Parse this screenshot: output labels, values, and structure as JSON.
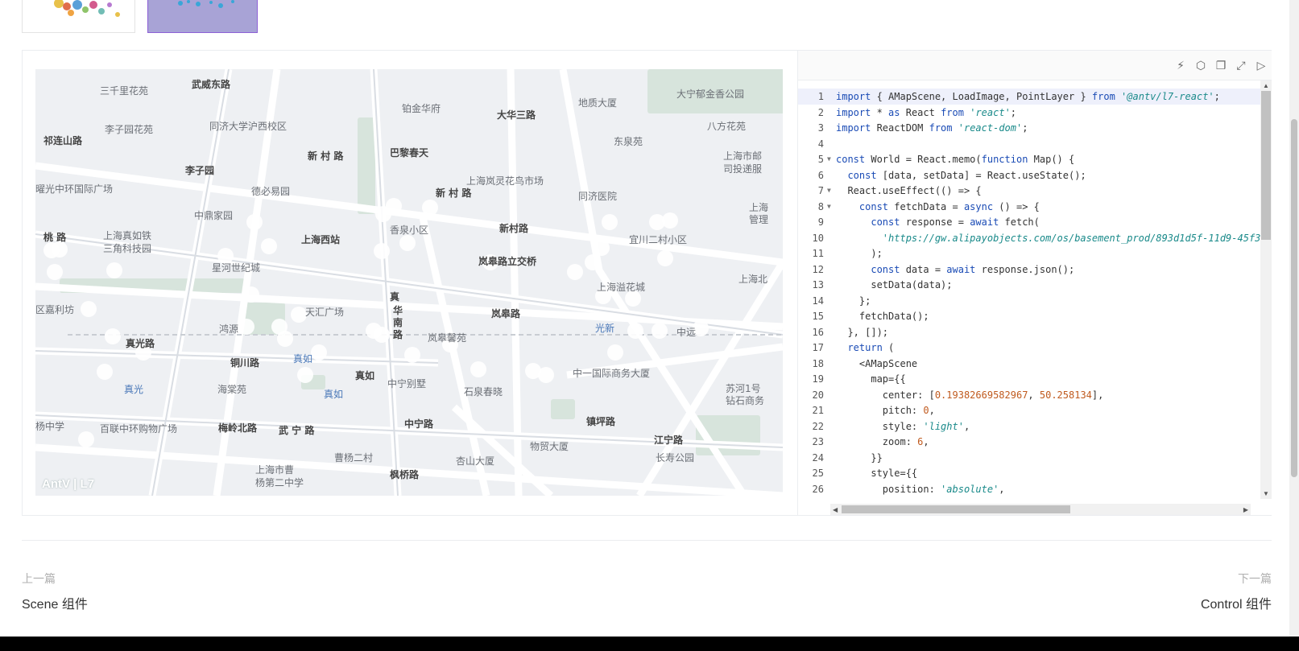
{
  "map": {
    "labels": [
      {
        "t": "三千里花苑",
        "cls": ""
      },
      {
        "t": "武威东路",
        "cls": "b"
      },
      {
        "t": "铂金华府",
        "cls": ""
      },
      {
        "t": "大华三路",
        "cls": "b"
      },
      {
        "t": "地质大厦",
        "cls": ""
      },
      {
        "t": "大宁郁金香公园",
        "cls": ""
      },
      {
        "t": "李子园花苑",
        "cls": ""
      },
      {
        "t": "同济大学沪西校区",
        "cls": ""
      },
      {
        "t": "八方花苑",
        "cls": ""
      },
      {
        "t": "祁连山路",
        "cls": "b"
      },
      {
        "t": "新 村 路",
        "cls": "b"
      },
      {
        "t": "巴黎春天",
        "cls": "b"
      },
      {
        "t": "东泉苑",
        "cls": ""
      },
      {
        "t": "上海市邮",
        "cls": ""
      },
      {
        "t": "司投递服",
        "cls": ""
      },
      {
        "t": "李子园",
        "cls": "b"
      },
      {
        "t": "上海岚灵花鸟市场",
        "cls": ""
      },
      {
        "t": "曜光中环国际广场",
        "cls": ""
      },
      {
        "t": "德必易园",
        "cls": ""
      },
      {
        "t": "新 村 路",
        "cls": "b"
      },
      {
        "t": "同济医院",
        "cls": ""
      },
      {
        "t": "上海",
        "cls": ""
      },
      {
        "t": "管理",
        "cls": ""
      },
      {
        "t": "中鼎家园",
        "cls": ""
      },
      {
        "t": "香泉小区",
        "cls": ""
      },
      {
        "t": "新村路",
        "cls": "b"
      },
      {
        "t": "宜川二村小区",
        "cls": ""
      },
      {
        "t": "桃  路",
        "cls": "b"
      },
      {
        "t": "上海真如铁",
        "cls": ""
      },
      {
        "t": "三角科技园",
        "cls": ""
      },
      {
        "t": "上海西站",
        "cls": "b"
      },
      {
        "t": "岚皋路立交桥",
        "cls": "b"
      },
      {
        "t": "星河世纪城",
        "cls": ""
      },
      {
        "t": "上海北",
        "cls": ""
      },
      {
        "t": "上海溢花城",
        "cls": ""
      },
      {
        "t": "区嘉利坊",
        "cls": ""
      },
      {
        "t": "天汇广场",
        "cls": ""
      },
      {
        "t": "岚皋路",
        "cls": "b"
      },
      {
        "t": "光新",
        "cls": "blue"
      },
      {
        "t": "鸿源",
        "cls": ""
      },
      {
        "t": "岚皋馨苑",
        "cls": ""
      },
      {
        "t": "中远",
        "cls": ""
      },
      {
        "t": "真光路",
        "cls": "b"
      },
      {
        "t": "铜川路",
        "cls": "b"
      },
      {
        "t": "真如",
        "cls": "blue"
      },
      {
        "t": "中一国际商务大厦",
        "cls": ""
      },
      {
        "t": "真如",
        "cls": "b"
      },
      {
        "t": "中宁别墅",
        "cls": ""
      },
      {
        "t": "真光",
        "cls": "blue"
      },
      {
        "t": "海棠苑",
        "cls": ""
      },
      {
        "t": "真如",
        "cls": "blue"
      },
      {
        "t": "石泉春晓",
        "cls": ""
      },
      {
        "t": "苏河1号",
        "cls": ""
      },
      {
        "t": "钻石商务",
        "cls": ""
      },
      {
        "t": "杨中学",
        "cls": ""
      },
      {
        "t": "百联中环购物广场",
        "cls": ""
      },
      {
        "t": "梅岭北路",
        "cls": "b"
      },
      {
        "t": "武 宁 路",
        "cls": "b"
      },
      {
        "t": "中宁路",
        "cls": "b"
      },
      {
        "t": "镇坪路",
        "cls": "b"
      },
      {
        "t": "物贸大厦",
        "cls": ""
      },
      {
        "t": "江宁路",
        "cls": "b"
      },
      {
        "t": "上海市曹",
        "cls": ""
      },
      {
        "t": "杨第二中学",
        "cls": ""
      },
      {
        "t": "曹杨二村",
        "cls": ""
      },
      {
        "t": "枫桥路",
        "cls": "b"
      },
      {
        "t": "杏山大厦",
        "cls": ""
      },
      {
        "t": "长寿公园",
        "cls": ""
      },
      {
        "t": "真",
        "cls": "b"
      },
      {
        "t": "华",
        "cls": "b"
      },
      {
        "t": "南",
        "cls": "b"
      },
      {
        "t": "路",
        "cls": "b"
      }
    ],
    "logo": "AntV | L7"
  },
  "toolbar": {
    "icons": [
      "lightning-icon",
      "cube-icon",
      "copy-icon",
      "fullscreen-icon",
      "play-icon"
    ]
  },
  "code": {
    "lines": [
      "import { AMapScene, LoadImage, PointLayer } from '@antv/l7-react';",
      "import * as React from 'react';",
      "import ReactDOM from 'react-dom';",
      "",
      "const World = React.memo(function Map() {",
      "  const [data, setData] = React.useState();",
      "  React.useEffect(() => {",
      "    const fetchData = async () => {",
      "      const response = await fetch(",
      "        'https://gw.alipayobjects.com/os/basement_prod/893d1d5f-11d9-45f3",
      "      );",
      "      const data = await response.json();",
      "      setData(data);",
      "    };",
      "    fetchData();",
      "  }, []);",
      "  return (",
      "    <AMapScene",
      "      map={{",
      "        center: [0.19382669582967, 50.258134],",
      "        pitch: 0,",
      "        style: 'light',",
      "        zoom: 6,",
      "      }}",
      "      style={{",
      "        position: 'absolute',",
      "  "
    ],
    "folds": [
      5,
      7,
      8
    ]
  },
  "nav": {
    "prev_label": "上一篇",
    "prev_title": "Scene 组件",
    "next_label": "下一篇",
    "next_title": "Control 组件"
  }
}
